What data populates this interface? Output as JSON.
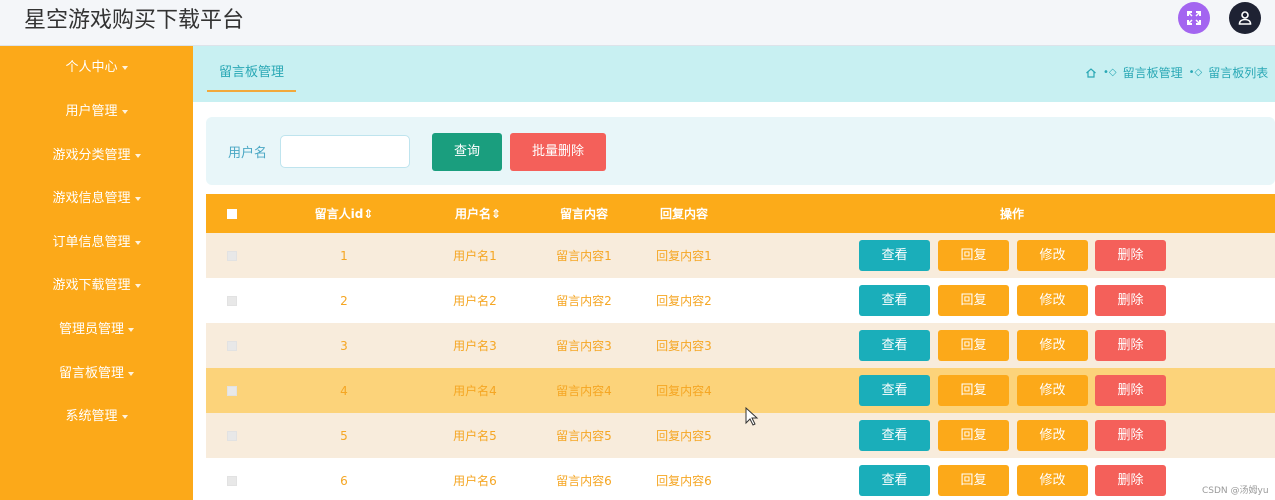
{
  "app": {
    "title": "星空游戏购买下载平台"
  },
  "header": {
    "fullscreen_icon": "fullscreen-icon",
    "user_icon": "user-icon"
  },
  "sidebar": {
    "items": [
      {
        "label": "个人中心"
      },
      {
        "label": "用户管理"
      },
      {
        "label": "游戏分类管理"
      },
      {
        "label": "游戏信息管理"
      },
      {
        "label": "订单信息管理"
      },
      {
        "label": "游戏下载管理"
      },
      {
        "label": "管理员管理"
      },
      {
        "label": "留言板管理"
      },
      {
        "label": "系统管理"
      }
    ]
  },
  "topbar": {
    "tab": "留言板管理",
    "breadcrumb": [
      "留言板管理",
      "留言板列表"
    ]
  },
  "search": {
    "label": "用户名",
    "input_value": "",
    "query_button": "查询",
    "batch_delete_button": "批量删除"
  },
  "table": {
    "headers": [
      "留言人id",
      "用户名",
      "留言内容",
      "回复内容",
      "操作"
    ],
    "actions": {
      "view": "查看",
      "reply": "回复",
      "edit": "修改",
      "delete": "删除"
    },
    "rows": [
      {
        "id": "1",
        "username": "用户名1",
        "message": "留言内容1",
        "reply": "回复内容1"
      },
      {
        "id": "2",
        "username": "用户名2",
        "message": "留言内容2",
        "reply": "回复内容2"
      },
      {
        "id": "3",
        "username": "用户名3",
        "message": "留言内容3",
        "reply": "回复内容3"
      },
      {
        "id": "4",
        "username": "用户名4",
        "message": "留言内容4",
        "reply": "回复内容4"
      },
      {
        "id": "5",
        "username": "用户名5",
        "message": "留言内容5",
        "reply": "回复内容5"
      },
      {
        "id": "6",
        "username": "用户名6",
        "message": "留言内容6",
        "reply": "回复内容6"
      }
    ]
  },
  "watermark": "CSDN @汤姆yu",
  "colors": {
    "sidebar": "#fca919",
    "header_row": "#fca919",
    "query_button": "#1a9e7e",
    "danger": "#f4605a",
    "view_button": "#1aaeba",
    "row_odd": "#f8ecdc",
    "row_even": "#ffffff",
    "row_hover": "#fcd37a"
  }
}
